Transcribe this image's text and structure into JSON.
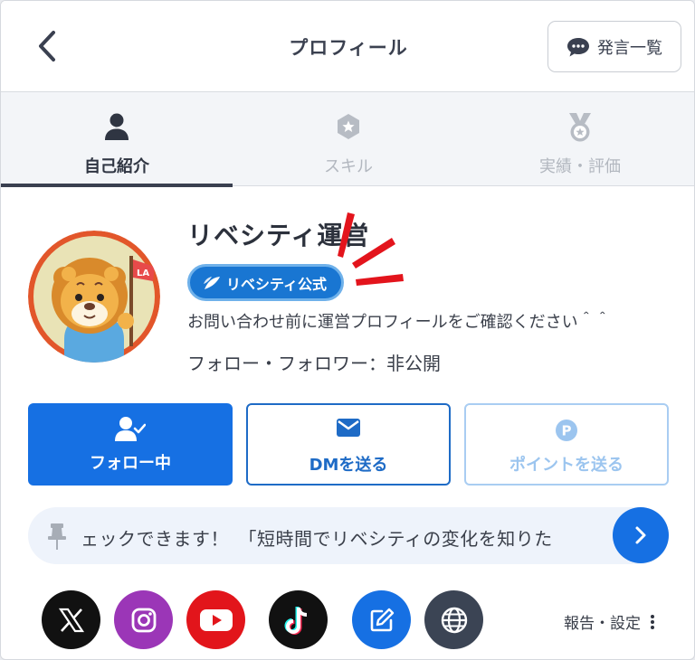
{
  "header": {
    "title": "プロフィール",
    "posts_button_label": "発言一覧"
  },
  "tabs": [
    {
      "label": "自己紹介",
      "icon": "person-icon",
      "active": true
    },
    {
      "label": "スキル",
      "icon": "skill-badge-icon",
      "active": false
    },
    {
      "label": "実績・評価",
      "icon": "medal-icon",
      "active": false
    }
  ],
  "profile": {
    "name": "リベシティ運営",
    "badge": "リベシティ公式",
    "bio": "お問い合わせ前に運営プロフィールをご確認ください＾＾",
    "follow_status": "フォロー・フォロワー：非公開",
    "avatar_flag_text": "LA"
  },
  "actions": {
    "follow": "フォロー中",
    "dm": "DMを送る",
    "point": "ポイントを送る"
  },
  "ticker": {
    "text": "ェックできます！　「短時間でリベシティの変化を知りた"
  },
  "social_links": [
    {
      "name": "x-icon",
      "color": "#111111"
    },
    {
      "name": "instagram-icon",
      "color": "#9b36b7"
    },
    {
      "name": "youtube-icon",
      "color": "#e2151b"
    },
    {
      "name": "tiktok-icon",
      "color": "#111111"
    },
    {
      "name": "edit-note-icon",
      "color": "#1670e3"
    },
    {
      "name": "globe-icon",
      "color": "#3b4454"
    }
  ],
  "footer": {
    "report_settings": "報告・設定"
  },
  "colors": {
    "primary": "#1670e3",
    "badge": "#1976d2",
    "text": "#2f3440",
    "muted": "#b2b7bf"
  }
}
